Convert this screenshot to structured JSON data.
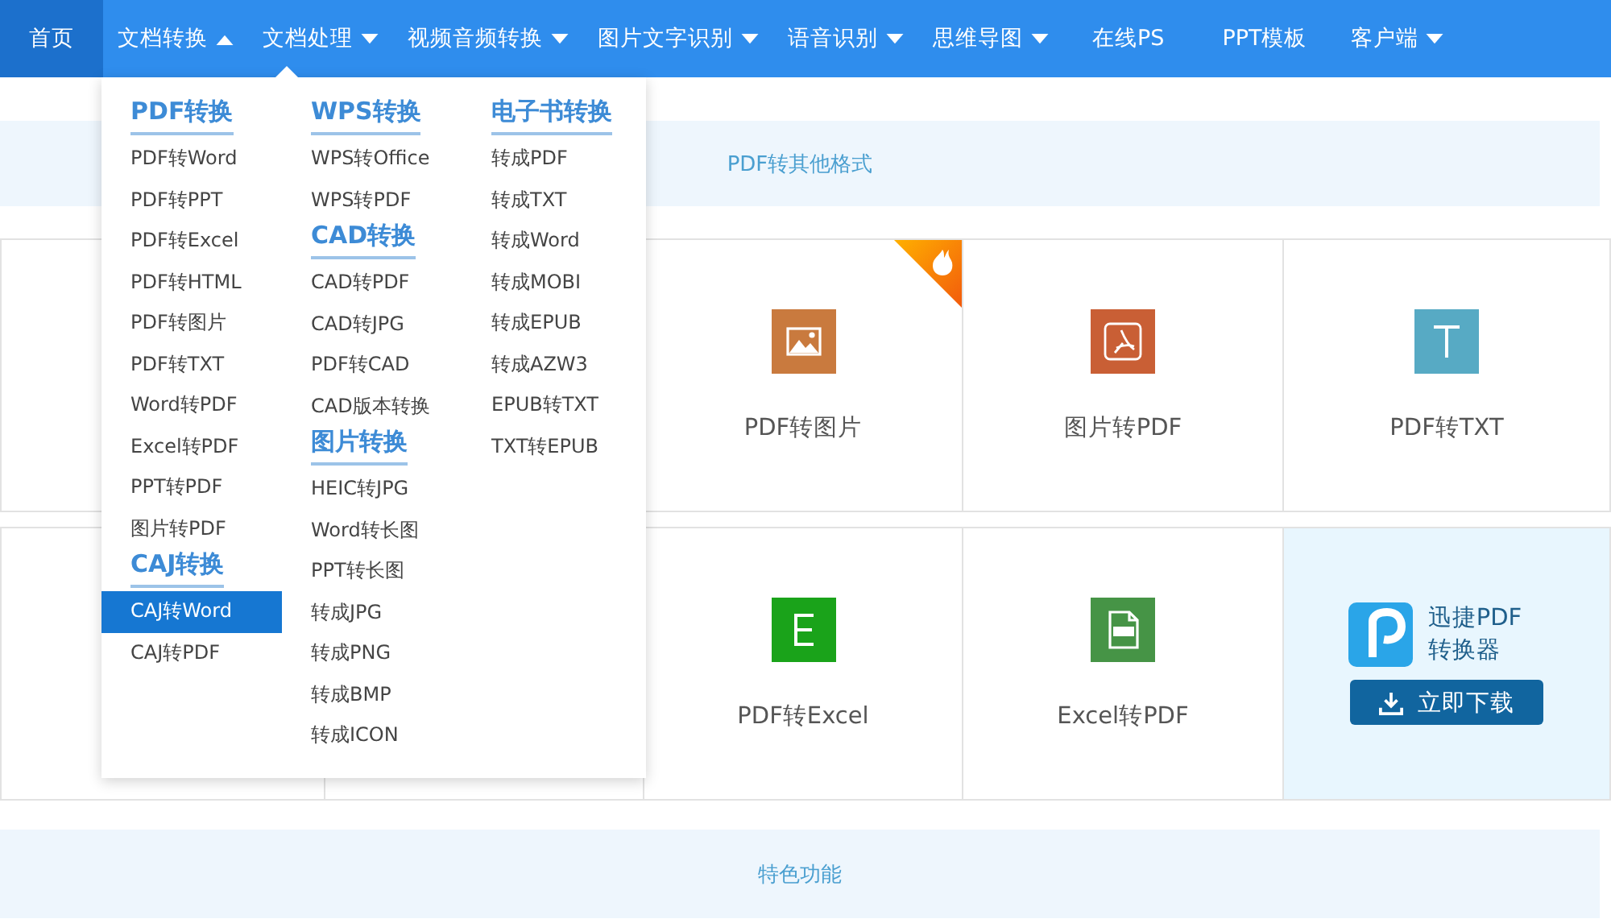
{
  "nav": {
    "items": [
      {
        "label": "首页",
        "selected": true,
        "has_menu": false
      },
      {
        "label": "文档转换",
        "selected": false,
        "has_menu": true,
        "expanded": true
      },
      {
        "label": "文档处理",
        "selected": false,
        "has_menu": true,
        "expanded": false
      },
      {
        "label": "视频音频转换",
        "selected": false,
        "has_menu": true,
        "expanded": false
      },
      {
        "label": "图片文字识别",
        "selected": false,
        "has_menu": true,
        "expanded": false
      },
      {
        "label": "语音识别",
        "selected": false,
        "has_menu": true,
        "expanded": false
      },
      {
        "label": "思维导图",
        "selected": false,
        "has_menu": true,
        "expanded": false
      },
      {
        "label": "在线PS",
        "selected": false,
        "has_menu": false
      },
      {
        "label": "PPT模板",
        "selected": false,
        "has_menu": false
      },
      {
        "label": "客户端",
        "selected": false,
        "has_menu": true,
        "expanded": false
      }
    ]
  },
  "dropdown": {
    "columns": [
      [
        {
          "heading": "PDF转换",
          "items": [
            {
              "label": "PDF转Word",
              "selected": false
            },
            {
              "label": "PDF转PPT",
              "selected": false
            },
            {
              "label": "PDF转Excel",
              "selected": false
            },
            {
              "label": "PDF转HTML",
              "selected": false
            },
            {
              "label": "PDF转图片",
              "selected": false
            },
            {
              "label": "PDF转TXT",
              "selected": false
            },
            {
              "label": "Word转PDF",
              "selected": false
            },
            {
              "label": "Excel转PDF",
              "selected": false
            },
            {
              "label": "PPT转PDF",
              "selected": false
            },
            {
              "label": "图片转PDF",
              "selected": false
            }
          ]
        },
        {
          "heading": "CAJ转换",
          "items": [
            {
              "label": "CAJ转Word",
              "selected": true
            },
            {
              "label": "CAJ转PDF",
              "selected": false
            }
          ]
        }
      ],
      [
        {
          "heading": "WPS转换",
          "items": [
            {
              "label": "WPS转Office",
              "selected": false
            },
            {
              "label": "WPS转PDF",
              "selected": false
            }
          ]
        },
        {
          "heading": "CAD转换",
          "items": [
            {
              "label": "CAD转PDF",
              "selected": false
            },
            {
              "label": "CAD转JPG",
              "selected": false
            },
            {
              "label": "PDF转CAD",
              "selected": false
            },
            {
              "label": "CAD版本转换",
              "selected": false
            }
          ]
        },
        {
          "heading": "图片转换",
          "items": [
            {
              "label": "HEIC转JPG",
              "selected": false
            },
            {
              "label": "Word转长图",
              "selected": false
            },
            {
              "label": "PPT转长图",
              "selected": false
            },
            {
              "label": "转成JPG",
              "selected": false
            },
            {
              "label": "转成PNG",
              "selected": false
            },
            {
              "label": "转成BMP",
              "selected": false
            },
            {
              "label": "转成ICON",
              "selected": false
            }
          ]
        }
      ],
      [
        {
          "heading": "电子书转换",
          "items": [
            {
              "label": "转成PDF",
              "selected": false
            },
            {
              "label": "转成TXT",
              "selected": false
            },
            {
              "label": "转成Word",
              "selected": false
            },
            {
              "label": "转成MOBI",
              "selected": false
            },
            {
              "label": "转成EPUB",
              "selected": false
            },
            {
              "label": "转成AZW3",
              "selected": false
            },
            {
              "label": "EPUB转TXT",
              "selected": false
            },
            {
              "label": "TXT转EPUB",
              "selected": false
            }
          ]
        }
      ]
    ]
  },
  "section_title": "PDF转其他格式",
  "tiles": [
    [
      {
        "kind": "covered"
      },
      {
        "kind": "covered"
      },
      {
        "kind": "image",
        "label": "PDF转图片",
        "hot": true
      },
      {
        "kind": "pdf",
        "label": "图片转PDF",
        "hot": false
      },
      {
        "kind": "text",
        "label": "PDF转TXT",
        "hot": false
      }
    ],
    [
      {
        "kind": "covered"
      },
      {
        "kind": "covered"
      },
      {
        "kind": "sheet",
        "label": "PDF转Excel",
        "hot": false
      },
      {
        "kind": "document",
        "label": "Excel转PDF",
        "hot": false
      },
      {
        "kind": "promo",
        "name": "迅捷PDF",
        "subname": "转换器",
        "button": "立即下载"
      }
    ]
  ],
  "bottom_title": "特色功能"
}
